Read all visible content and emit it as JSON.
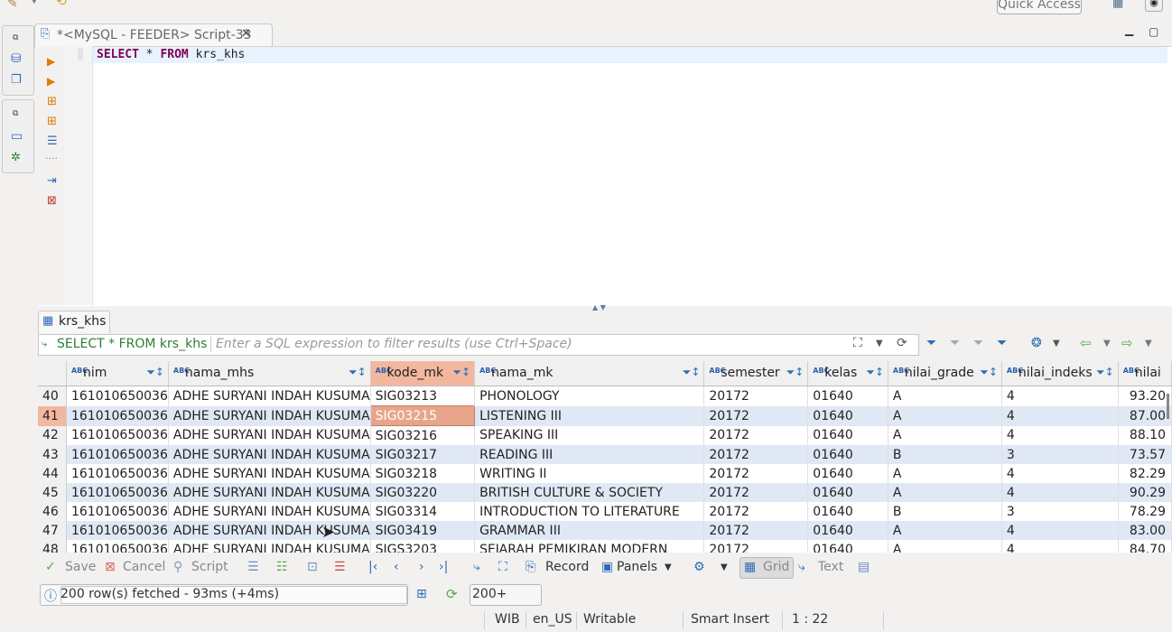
{
  "window": {
    "quick_access": "Quick Access"
  },
  "editor": {
    "tab_title": "*<MySQL - FEEDER> Script-33",
    "sql_kw1": "SELECT",
    "sql_star": " * ",
    "sql_kw2": "FROM",
    "sql_table": " krs_khs"
  },
  "results": {
    "tab_label": "krs_khs",
    "filter_query": "SELECT * FROM krs_khs",
    "filter_placeholder": "Enter a SQL expression to filter results (use Ctrl+Space)",
    "columns": [
      "nim",
      "nama_mhs",
      "kode_mk",
      "nama_mk",
      "semester",
      "kelas",
      "nilai_grade",
      "nilai_indeks",
      "nilai"
    ],
    "selected_column": "kode_mk",
    "rows": [
      {
        "n": "40",
        "nim": "161010650036",
        "nama_mhs": "ADHE SURYANI INDAH KUSUMA",
        "kode_mk": "SIG03213",
        "nama_mk": "PHONOLOGY",
        "semester": "20172",
        "kelas": "01640",
        "grade": "A",
        "indeks": "4",
        "nilai": "93.20"
      },
      {
        "n": "41",
        "nim": "161010650036",
        "nama_mhs": "ADHE SURYANI INDAH KUSUMA",
        "kode_mk": "SIG03215",
        "nama_mk": "LISTENING III",
        "semester": "20172",
        "kelas": "01640",
        "grade": "A",
        "indeks": "4",
        "nilai": "87.00"
      },
      {
        "n": "42",
        "nim": "161010650036",
        "nama_mhs": "ADHE SURYANI INDAH KUSUMA",
        "kode_mk": "SIG03216",
        "nama_mk": "SPEAKING III",
        "semester": "20172",
        "kelas": "01640",
        "grade": "A",
        "indeks": "4",
        "nilai": "88.10"
      },
      {
        "n": "43",
        "nim": "161010650036",
        "nama_mhs": "ADHE SURYANI INDAH KUSUMA",
        "kode_mk": "SIG03217",
        "nama_mk": "READING III",
        "semester": "20172",
        "kelas": "01640",
        "grade": "B",
        "indeks": "3",
        "nilai": "73.57"
      },
      {
        "n": "44",
        "nim": "161010650036",
        "nama_mhs": "ADHE SURYANI INDAH KUSUMA",
        "kode_mk": "SIG03218",
        "nama_mk": "WRITING II",
        "semester": "20172",
        "kelas": "01640",
        "grade": "A",
        "indeks": "4",
        "nilai": "82.29"
      },
      {
        "n": "45",
        "nim": "161010650036",
        "nama_mhs": "ADHE SURYANI INDAH KUSUMA",
        "kode_mk": "SIG03220",
        "nama_mk": "BRITISH CULTURE & SOCIETY",
        "semester": "20172",
        "kelas": "01640",
        "grade": "A",
        "indeks": "4",
        "nilai": "90.29"
      },
      {
        "n": "46",
        "nim": "161010650036",
        "nama_mhs": "ADHE SURYANI INDAH KUSUMA",
        "kode_mk": "SIG03314",
        "nama_mk": "INTRODUCTION TO LITERATURE",
        "semester": "20172",
        "kelas": "01640",
        "grade": "B",
        "indeks": "3",
        "nilai": "78.29"
      },
      {
        "n": "47",
        "nim": "161010650036",
        "nama_mhs": "ADHE SURYANI INDAH KUSUMA",
        "kode_mk": "SIG03419",
        "nama_mk": "GRAMMAR III",
        "semester": "20172",
        "kelas": "01640",
        "grade": "A",
        "indeks": "4",
        "nilai": "83.00"
      },
      {
        "n": "48",
        "nim": "161010650036",
        "nama_mhs": "ADHE SURYANI INDAH KUSUMA",
        "kode_mk": "SIGS3203",
        "nama_mk": "SEJARAH PEMIKIRAN MODERN",
        "semester": "20172",
        "kelas": "01640",
        "grade": "A",
        "indeks": "4",
        "nilai": "84.70"
      }
    ]
  },
  "toolbar": {
    "save": "Save",
    "cancel": "Cancel",
    "script": "Script",
    "record": "Record",
    "panels": "Panels",
    "grid": "Grid",
    "text": "Text"
  },
  "status": {
    "fetched": "200 row(s) fetched - 93ms (+4ms)",
    "fetch_size": "200+",
    "timezone": "WIB",
    "locale": "en_US",
    "mode": "Writable",
    "insert": "Smart Insert",
    "position": "1 : 22"
  },
  "colors": {
    "selection": "#e8a58c",
    "alt_row": "#dfe8f4",
    "keyword": "#7f0055",
    "filter_text": "#2e7d32"
  }
}
